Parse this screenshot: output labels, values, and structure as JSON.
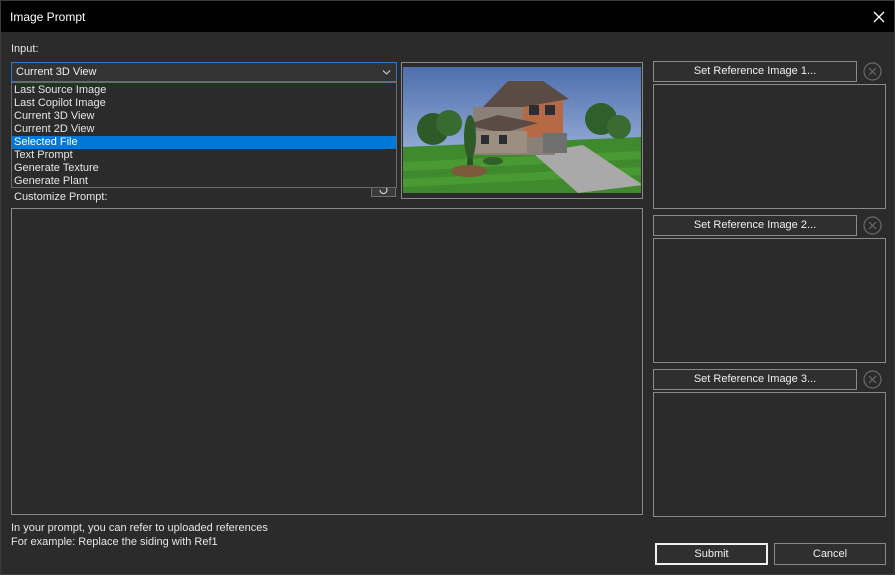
{
  "window": {
    "title": "Image Prompt"
  },
  "input": {
    "label": "Input:",
    "selected": "Current 3D View",
    "options": [
      "Last Source Image",
      "Last Copilot Image",
      "Current 3D View",
      "Current 2D View",
      "Selected File",
      "Text Prompt",
      "Generate Texture",
      "Generate Plant"
    ],
    "highlighted_option": "Selected File"
  },
  "prompt": {
    "label": "Customize Prompt:",
    "value": ""
  },
  "references": [
    {
      "button_label": "Set Reference Image 1..."
    },
    {
      "button_label": "Set Reference Image 2..."
    },
    {
      "button_label": "Set Reference Image 3..."
    }
  ],
  "hints": {
    "line1": "In your prompt, you can refer to uploaded references",
    "line2": "For example: Replace the siding with Ref1"
  },
  "actions": {
    "submit_label": "Submit",
    "cancel_label": "Cancel"
  },
  "colors": {
    "background": "#2b2b2b",
    "titlebar": "#000000",
    "selection": "#0078d7",
    "focus_border": "#2d79c7"
  }
}
